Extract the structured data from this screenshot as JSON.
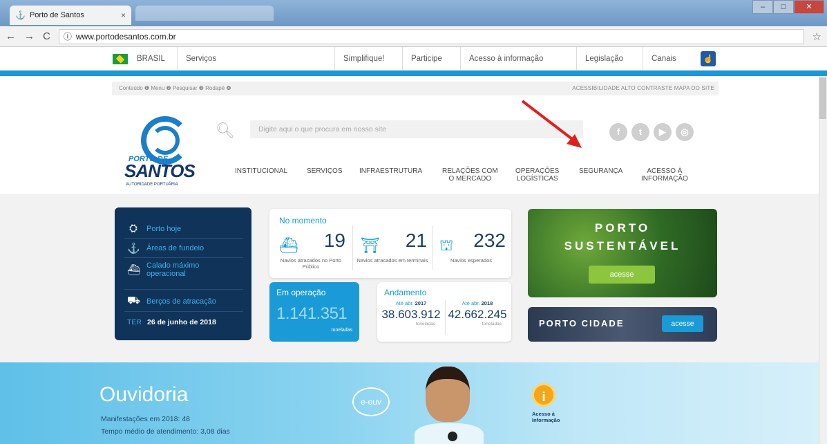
{
  "browser": {
    "tab_title": "Porto de Santos",
    "tab_close": "×",
    "url": "www.portodesantos.com.br"
  },
  "govbar": {
    "country": "BRASIL",
    "items": [
      "Serviços",
      "Simplifique!",
      "Participe",
      "Acesso à informação",
      "Legislação",
      "Canais"
    ]
  },
  "utility": {
    "left": "Conteúdo ❶  Menu ❷  Pesquisar ❸  Rodapé ❹",
    "right": "ACESSIBILIDADE   ALTO CONTRASTE   MAPA DO SITE"
  },
  "logo": {
    "line1": "PORTO DE",
    "line2": "SANTOS",
    "line3": "AUTORIDADE PORTUÁRIA"
  },
  "search": {
    "placeholder": "Digite aqui o que procura em nosso site"
  },
  "social": [
    "f",
    "t",
    "▶",
    "◎"
  ],
  "nav": [
    {
      "l1": "INSTITUCIONAL",
      "l2": ""
    },
    {
      "l1": "SERVIÇOS",
      "l2": ""
    },
    {
      "l1": "INFRAESTRUTURA",
      "l2": ""
    },
    {
      "l1": "RELAÇÕES COM",
      "l2": "O MERCADO"
    },
    {
      "l1": "OPERAÇÕES",
      "l2": "LOGÍSTICAS"
    },
    {
      "l1": "SEGURANÇA",
      "l2": ""
    },
    {
      "l1": "ACESSO À",
      "l2": "INFORMAÇÃO"
    }
  ],
  "quick": {
    "items": [
      "Porto hoje",
      "Áreas de fundeio",
      "Calado máximo operacional",
      "Berços de atracação"
    ],
    "day": "TER",
    "date": "26 de junho de 2018"
  },
  "momento": {
    "title": "No momento",
    "stats": [
      {
        "value": "19",
        "label": "Navios atracados no Porto Público"
      },
      {
        "value": "21",
        "label": "Navios atracados em terminais"
      },
      {
        "value": "232",
        "label": "Navios esperados"
      }
    ]
  },
  "operacao": {
    "title": "Em operação",
    "value": "1.141.351",
    "unit": "toneladas"
  },
  "andamento": {
    "title": "Andamento",
    "cols": [
      {
        "prefix": "Até abr.",
        "year": "2017",
        "value": "38.603.912",
        "unit": "toneladas"
      },
      {
        "prefix": "Até abr.",
        "year": "2018",
        "value": "42.662.245",
        "unit": "toneladas"
      }
    ]
  },
  "sustentavel": {
    "line1": "PORTO",
    "line2": "SUSTENTÁVEL",
    "button": "acesse"
  },
  "cidade": {
    "title": "PORTO CIDADE",
    "button": "acesse"
  },
  "ouvidoria": {
    "title": "Ouvidoria",
    "line1": "Manifestações em 2018: 48",
    "line2": "Tempo médio de atendimento: 3,08 dias",
    "badge": "e-ouv",
    "info_label1": "Acesso à",
    "info_label2": "Informação"
  }
}
